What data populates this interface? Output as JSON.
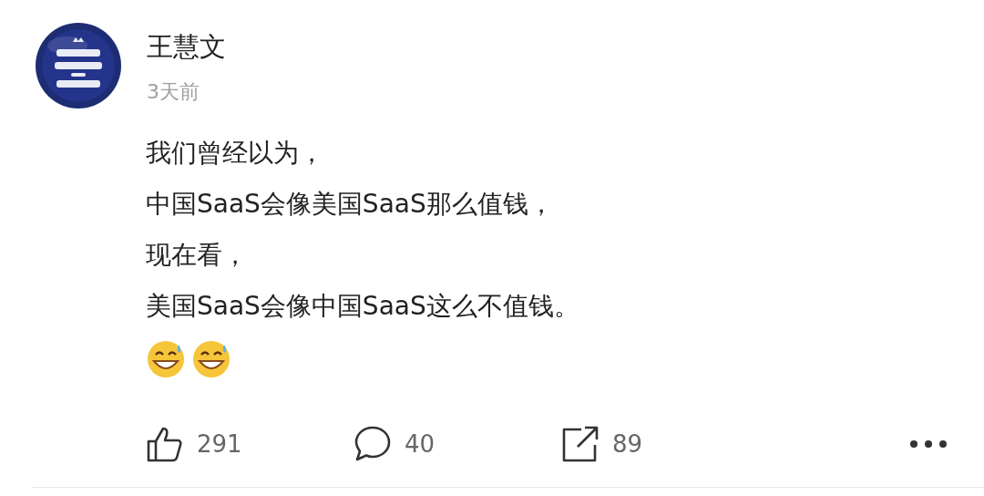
{
  "post": {
    "author": "王慧文",
    "time": "3天前",
    "lines": [
      "我们曾经以为，",
      "中国SaaS会像美国SaaS那么值钱，",
      "现在看，",
      "美国SaaS会像中国SaaS这么不值钱。"
    ],
    "emojis": [
      {
        "kind": "grin_sweat"
      },
      {
        "kind": "grin_sweat"
      }
    ],
    "actions": [
      {
        "kind": "like",
        "count": "291"
      },
      {
        "kind": "comment",
        "count": "40"
      },
      {
        "kind": "share",
        "count": "89"
      }
    ]
  }
}
